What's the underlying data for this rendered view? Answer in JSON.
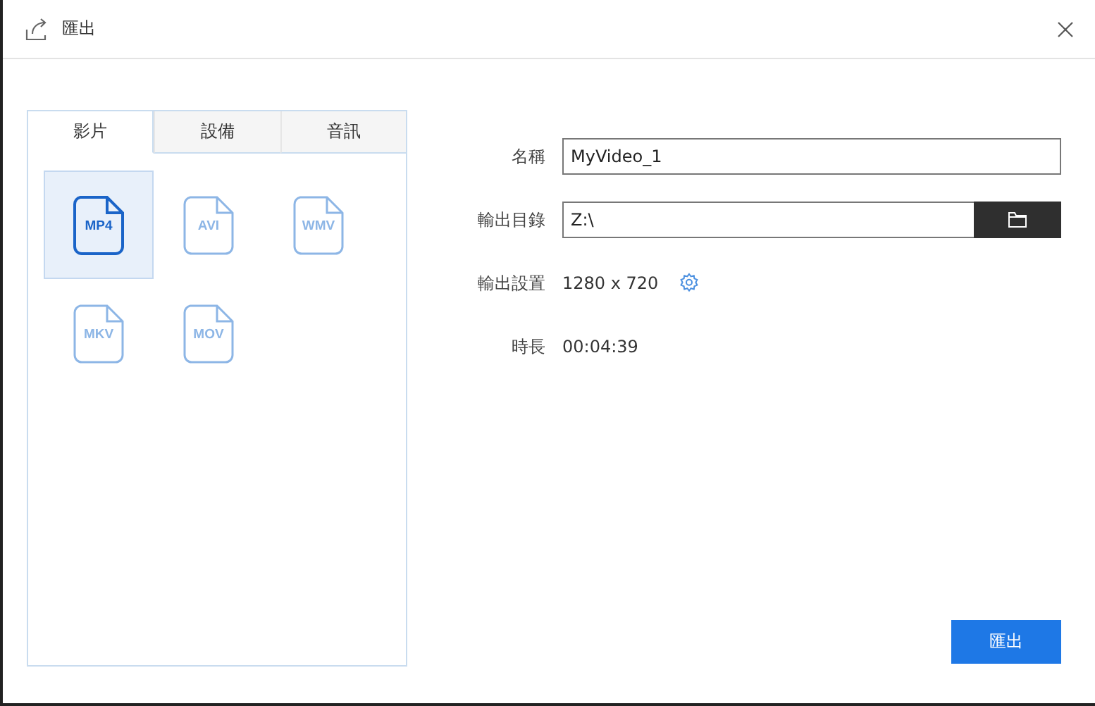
{
  "window": {
    "title": "匯出"
  },
  "tabs": [
    {
      "label": "影片",
      "selected": true
    },
    {
      "label": "設備",
      "selected": false
    },
    {
      "label": "音訊",
      "selected": false
    }
  ],
  "formats": [
    {
      "label": "MP4",
      "selected": true
    },
    {
      "label": "AVI",
      "selected": false
    },
    {
      "label": "WMV",
      "selected": false
    },
    {
      "label": "MKV",
      "selected": false
    },
    {
      "label": "MOV",
      "selected": false
    }
  ],
  "fields": [
    {
      "kind": "input",
      "label": "名稱",
      "value": "MyVideo_1"
    },
    {
      "kind": "folder",
      "label": "輸出目錄",
      "value": "Z:\\"
    },
    {
      "kind": "setting",
      "label": "輸出設置",
      "value": "1280 x 720"
    },
    {
      "kind": "text",
      "label": "時長",
      "value": "00:04:39"
    }
  ],
  "export_button": "匯出"
}
